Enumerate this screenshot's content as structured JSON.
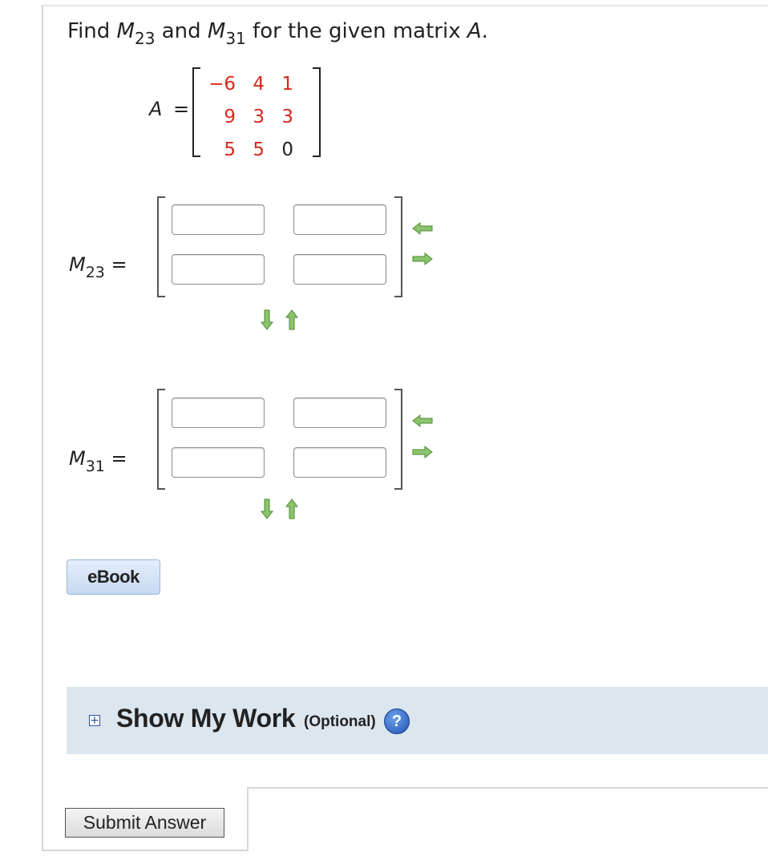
{
  "question": {
    "prefix": "Find ",
    "m_letter": "M",
    "sub1": "23",
    "and": " and ",
    "sub2": "31",
    "suffix": " for the given matrix ",
    "a_letter": "A",
    "period": "."
  },
  "matrix_a": {
    "label": "A",
    "equals": "=",
    "rows": [
      [
        "−6",
        "4",
        "1"
      ],
      [
        "9",
        "3",
        "3"
      ],
      [
        "5",
        "5",
        "0"
      ]
    ]
  },
  "m23": {
    "letter": "M",
    "sub": "23",
    "equals": " =",
    "cells": [
      "",
      "",
      "",
      ""
    ]
  },
  "m31": {
    "letter": "M",
    "sub": "31",
    "equals": " =",
    "cells": [
      "",
      "",
      "",
      ""
    ]
  },
  "icons": {
    "remove_col": "left-arrow-icon",
    "add_col": "right-arrow-icon",
    "add_row": "down-arrow-icon",
    "remove_row": "up-arrow-icon"
  },
  "colors": {
    "accent_red": "#d8281d",
    "arrow_green": "#5a9e3a",
    "panel_bg": "#dce6ef"
  },
  "ebook_label": "eBook",
  "show_my_work": {
    "toggle": "+",
    "title": "Show My Work",
    "optional": "(Optional)",
    "help": "?"
  },
  "submit_label": "Submit Answer"
}
